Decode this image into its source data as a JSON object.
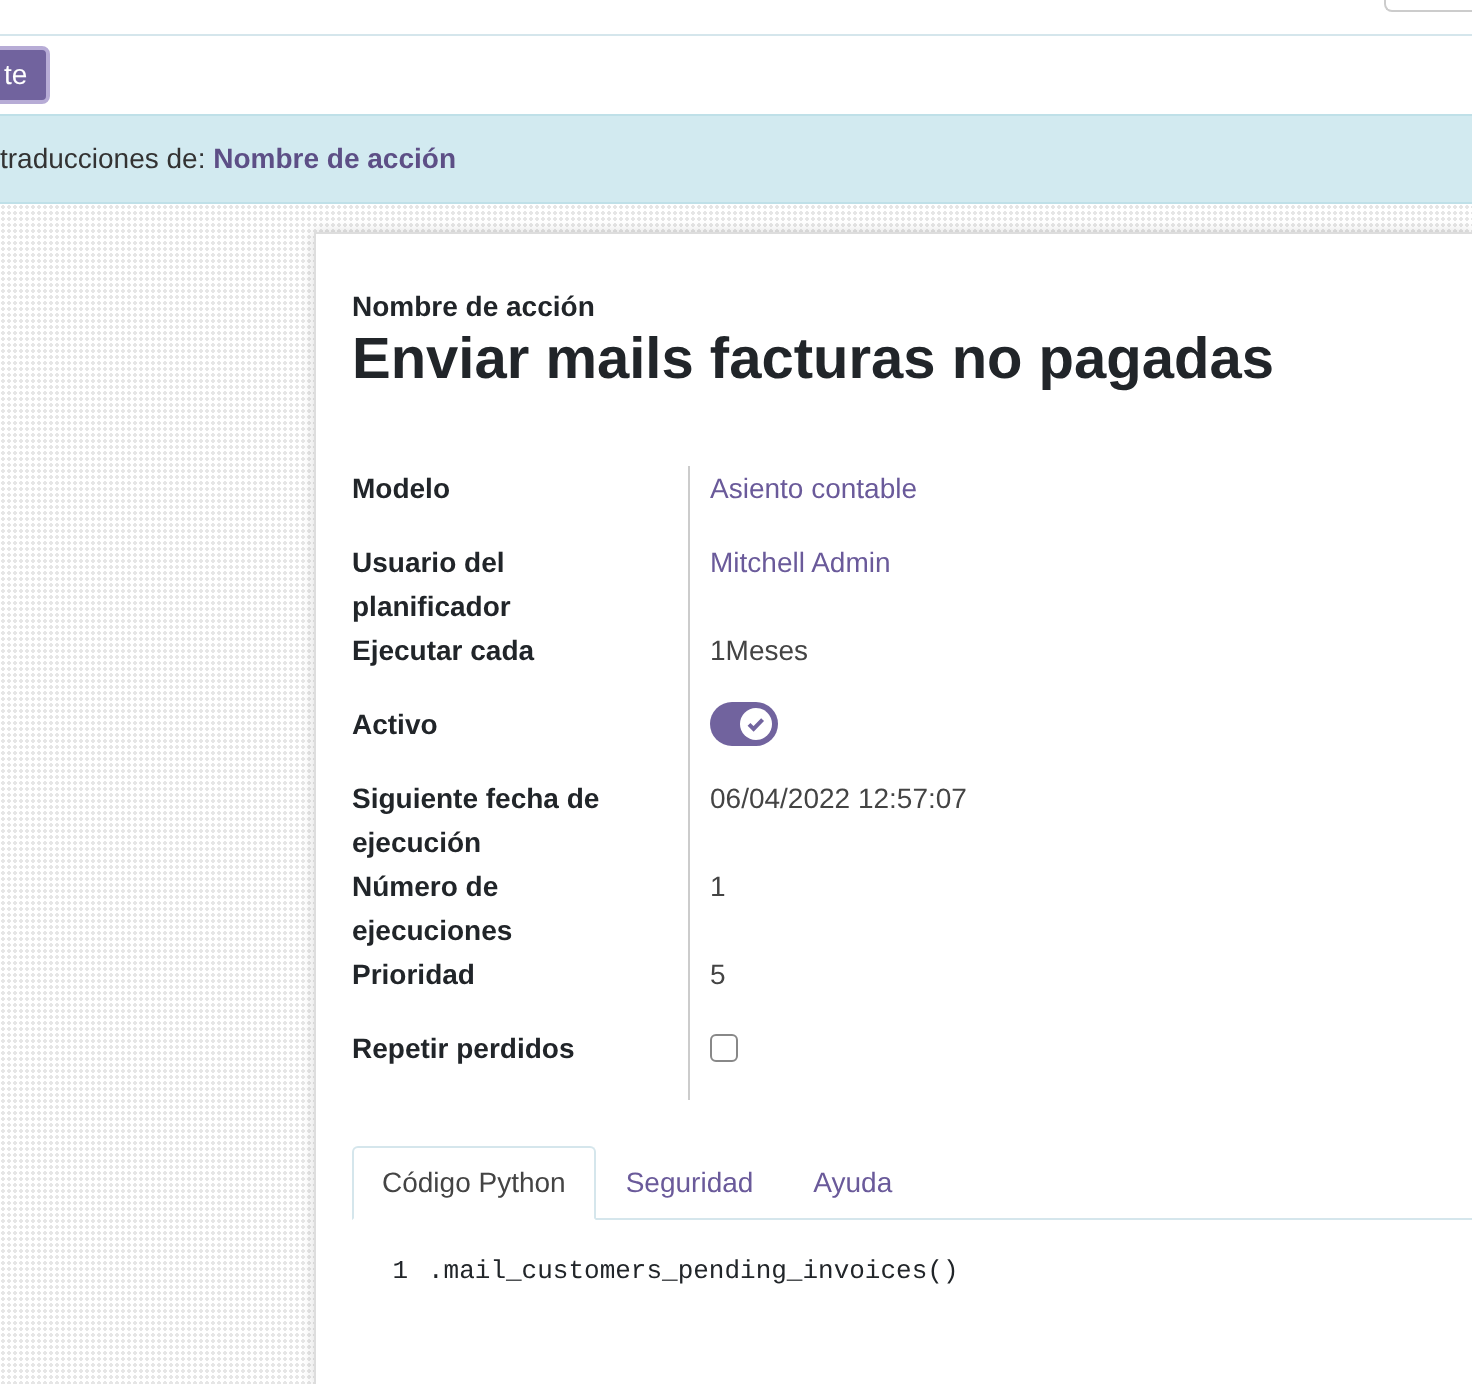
{
  "top_button": {
    "label": "te"
  },
  "alert": {
    "text": "traducciones de: ",
    "link": "Nombre de acción"
  },
  "form": {
    "title_label": "Nombre de acción",
    "title": "Enviar mails facturas no pagadas",
    "fields": [
      {
        "label": "Modelo",
        "kind": "link",
        "value": "Asiento contable"
      },
      {
        "label": "Usuario del planificador",
        "kind": "link",
        "value": "Mitchell Admin"
      },
      {
        "label": "Ejecutar cada",
        "kind": "text",
        "value": "1Meses"
      },
      {
        "label": "Activo",
        "kind": "toggle",
        "on": true
      },
      {
        "label": "Siguiente fecha de ejecución",
        "kind": "text",
        "value": "06/04/2022 12:57:07"
      },
      {
        "label": "Número de ejecuciones",
        "kind": "text",
        "value": "1"
      },
      {
        "label": "Prioridad",
        "kind": "text",
        "value": "5"
      },
      {
        "label": "Repetir perdidos",
        "kind": "checkbox",
        "checked": false
      }
    ],
    "tabs": [
      {
        "label": "Código Python",
        "selected": true
      },
      {
        "label": "Seguridad",
        "selected": false
      },
      {
        "label": "Ayuda",
        "selected": false
      }
    ],
    "code": [
      {
        "number": "1",
        "text": ".mail_customers_pending_invoices()"
      }
    ]
  }
}
